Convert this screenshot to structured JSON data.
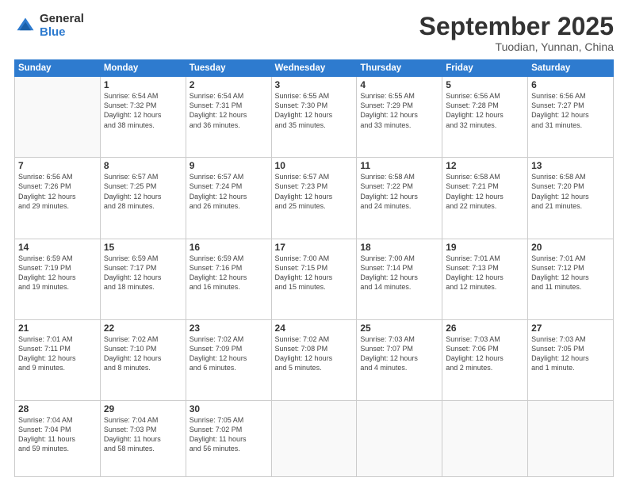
{
  "logo": {
    "general": "General",
    "blue": "Blue"
  },
  "header": {
    "month": "September 2025",
    "location": "Tuodian, Yunnan, China"
  },
  "weekdays": [
    "Sunday",
    "Monday",
    "Tuesday",
    "Wednesday",
    "Thursday",
    "Friday",
    "Saturday"
  ],
  "weeks": [
    [
      {
        "day": null,
        "info": null
      },
      {
        "day": "1",
        "info": "Sunrise: 6:54 AM\nSunset: 7:32 PM\nDaylight: 12 hours\nand 38 minutes."
      },
      {
        "day": "2",
        "info": "Sunrise: 6:54 AM\nSunset: 7:31 PM\nDaylight: 12 hours\nand 36 minutes."
      },
      {
        "day": "3",
        "info": "Sunrise: 6:55 AM\nSunset: 7:30 PM\nDaylight: 12 hours\nand 35 minutes."
      },
      {
        "day": "4",
        "info": "Sunrise: 6:55 AM\nSunset: 7:29 PM\nDaylight: 12 hours\nand 33 minutes."
      },
      {
        "day": "5",
        "info": "Sunrise: 6:56 AM\nSunset: 7:28 PM\nDaylight: 12 hours\nand 32 minutes."
      },
      {
        "day": "6",
        "info": "Sunrise: 6:56 AM\nSunset: 7:27 PM\nDaylight: 12 hours\nand 31 minutes."
      }
    ],
    [
      {
        "day": "7",
        "info": "Sunrise: 6:56 AM\nSunset: 7:26 PM\nDaylight: 12 hours\nand 29 minutes."
      },
      {
        "day": "8",
        "info": "Sunrise: 6:57 AM\nSunset: 7:25 PM\nDaylight: 12 hours\nand 28 minutes."
      },
      {
        "day": "9",
        "info": "Sunrise: 6:57 AM\nSunset: 7:24 PM\nDaylight: 12 hours\nand 26 minutes."
      },
      {
        "day": "10",
        "info": "Sunrise: 6:57 AM\nSunset: 7:23 PM\nDaylight: 12 hours\nand 25 minutes."
      },
      {
        "day": "11",
        "info": "Sunrise: 6:58 AM\nSunset: 7:22 PM\nDaylight: 12 hours\nand 24 minutes."
      },
      {
        "day": "12",
        "info": "Sunrise: 6:58 AM\nSunset: 7:21 PM\nDaylight: 12 hours\nand 22 minutes."
      },
      {
        "day": "13",
        "info": "Sunrise: 6:58 AM\nSunset: 7:20 PM\nDaylight: 12 hours\nand 21 minutes."
      }
    ],
    [
      {
        "day": "14",
        "info": "Sunrise: 6:59 AM\nSunset: 7:19 PM\nDaylight: 12 hours\nand 19 minutes."
      },
      {
        "day": "15",
        "info": "Sunrise: 6:59 AM\nSunset: 7:17 PM\nDaylight: 12 hours\nand 18 minutes."
      },
      {
        "day": "16",
        "info": "Sunrise: 6:59 AM\nSunset: 7:16 PM\nDaylight: 12 hours\nand 16 minutes."
      },
      {
        "day": "17",
        "info": "Sunrise: 7:00 AM\nSunset: 7:15 PM\nDaylight: 12 hours\nand 15 minutes."
      },
      {
        "day": "18",
        "info": "Sunrise: 7:00 AM\nSunset: 7:14 PM\nDaylight: 12 hours\nand 14 minutes."
      },
      {
        "day": "19",
        "info": "Sunrise: 7:01 AM\nSunset: 7:13 PM\nDaylight: 12 hours\nand 12 minutes."
      },
      {
        "day": "20",
        "info": "Sunrise: 7:01 AM\nSunset: 7:12 PM\nDaylight: 12 hours\nand 11 minutes."
      }
    ],
    [
      {
        "day": "21",
        "info": "Sunrise: 7:01 AM\nSunset: 7:11 PM\nDaylight: 12 hours\nand 9 minutes."
      },
      {
        "day": "22",
        "info": "Sunrise: 7:02 AM\nSunset: 7:10 PM\nDaylight: 12 hours\nand 8 minutes."
      },
      {
        "day": "23",
        "info": "Sunrise: 7:02 AM\nSunset: 7:09 PM\nDaylight: 12 hours\nand 6 minutes."
      },
      {
        "day": "24",
        "info": "Sunrise: 7:02 AM\nSunset: 7:08 PM\nDaylight: 12 hours\nand 5 minutes."
      },
      {
        "day": "25",
        "info": "Sunrise: 7:03 AM\nSunset: 7:07 PM\nDaylight: 12 hours\nand 4 minutes."
      },
      {
        "day": "26",
        "info": "Sunrise: 7:03 AM\nSunset: 7:06 PM\nDaylight: 12 hours\nand 2 minutes."
      },
      {
        "day": "27",
        "info": "Sunrise: 7:03 AM\nSunset: 7:05 PM\nDaylight: 12 hours\nand 1 minute."
      }
    ],
    [
      {
        "day": "28",
        "info": "Sunrise: 7:04 AM\nSunset: 7:04 PM\nDaylight: 11 hours\nand 59 minutes."
      },
      {
        "day": "29",
        "info": "Sunrise: 7:04 AM\nSunset: 7:03 PM\nDaylight: 11 hours\nand 58 minutes."
      },
      {
        "day": "30",
        "info": "Sunrise: 7:05 AM\nSunset: 7:02 PM\nDaylight: 11 hours\nand 56 minutes."
      },
      {
        "day": null,
        "info": null
      },
      {
        "day": null,
        "info": null
      },
      {
        "day": null,
        "info": null
      },
      {
        "day": null,
        "info": null
      }
    ]
  ]
}
